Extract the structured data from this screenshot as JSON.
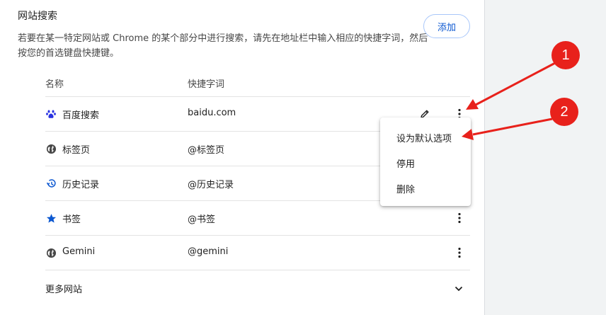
{
  "section": {
    "title": "网站搜索",
    "description": "若要在某一特定网站或 Chrome 的某个部分中进行搜索，请先在地址栏中输入相应的快捷字词，然后按您的首选键盘快捷键。",
    "add_label": "添加"
  },
  "table": {
    "col_name": "名称",
    "col_keyword": "快捷字词",
    "rows": [
      {
        "name": "百度搜索",
        "keyword": "baidu.com",
        "icon": "baidu-paw-icon"
      },
      {
        "name": "标签页",
        "keyword": "@标签页",
        "icon": "globe-icon"
      },
      {
        "name": "历史记录",
        "keyword": "@历史记录",
        "icon": "history-icon"
      },
      {
        "name": "书签",
        "keyword": "@书签",
        "icon": "star-icon"
      },
      {
        "name": "Gemini",
        "keyword": "@gemini",
        "icon": "globe-icon"
      }
    ],
    "more_sites": "更多网站"
  },
  "menu": {
    "set_default": "设为默认选项",
    "deactivate": "停用",
    "delete": "删除"
  },
  "annotations": {
    "badge1": "1",
    "badge2": "2",
    "color": "#e8211b"
  },
  "colors": {
    "accent": "#0b57d0",
    "icon_gray": "#474747"
  }
}
